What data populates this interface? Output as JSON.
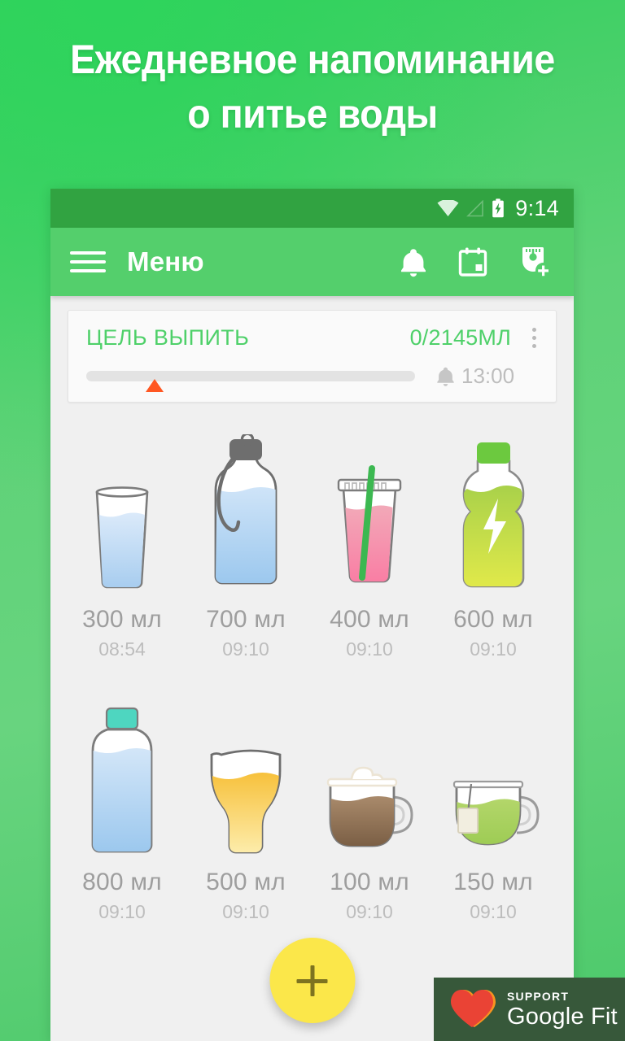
{
  "headline": {
    "line1": "Ежедневное напоминание",
    "line2": "о питье воды"
  },
  "statusbar": {
    "time": "9:14",
    "wifi_icon": "wifi-icon",
    "signal_icon": "signal-icon",
    "battery_icon": "battery-charging-icon"
  },
  "appbar": {
    "menu_icon": "hamburger-menu-icon",
    "title": "Меню",
    "bell_icon": "bell-icon",
    "calendar_icon": "calendar-icon",
    "add_cup_icon": "add-cup-icon"
  },
  "goal_card": {
    "label": "ЦЕЛЬ ВЫПИТЬ",
    "amount": "0/2145МЛ",
    "progress_percent": 0,
    "marker_position_percent": 18,
    "reminder_icon": "bell-icon",
    "reminder_time": "13:00",
    "overflow_icon": "kebab-menu-icon",
    "accent_color": "#4ed069"
  },
  "drinks": [
    {
      "icon": "glass-of-water-icon",
      "volume": "300 мл",
      "time": "08:54"
    },
    {
      "icon": "sports-bottle-icon",
      "volume": "700 мл",
      "time": "09:10"
    },
    {
      "icon": "smoothie-cup-icon",
      "volume": "400 мл",
      "time": "09:10"
    },
    {
      "icon": "energy-drink-icon",
      "volume": "600 мл",
      "time": "09:10"
    },
    {
      "icon": "water-bottle-icon",
      "volume": "800 мл",
      "time": "09:10"
    },
    {
      "icon": "beer-glass-icon",
      "volume": "500 мл",
      "time": "09:10"
    },
    {
      "icon": "coffee-cup-icon",
      "volume": "100 мл",
      "time": "09:10"
    },
    {
      "icon": "green-tea-cup-icon",
      "volume": "150 мл",
      "time": "09:10"
    }
  ],
  "fab": {
    "icon": "plus-icon",
    "color": "#fbe74a"
  },
  "fit_badge": {
    "support_label": "SUPPORT",
    "name": "Google Fit",
    "logo_icon": "google-fit-heart-icon"
  }
}
